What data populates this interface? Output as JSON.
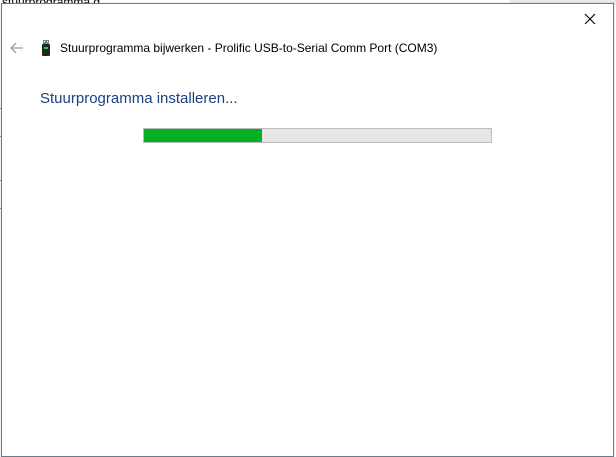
{
  "background": {
    "partial_text": "stuurprogramma d"
  },
  "window": {
    "title": "Stuurprogramma bijwerken - Prolific USB-to-Serial Comm Port (COM3)",
    "heading": "Stuurprogramma installeren...",
    "close_icon": "close-icon",
    "back_icon": "back-arrow-icon",
    "device_icon": "usb-device-icon"
  },
  "progress": {
    "fraction": 0.34,
    "fill_color": "#06b025",
    "track_color": "#e6e6e6"
  },
  "colors": {
    "heading": "#1c3f84",
    "border": "#6b7a8c"
  }
}
